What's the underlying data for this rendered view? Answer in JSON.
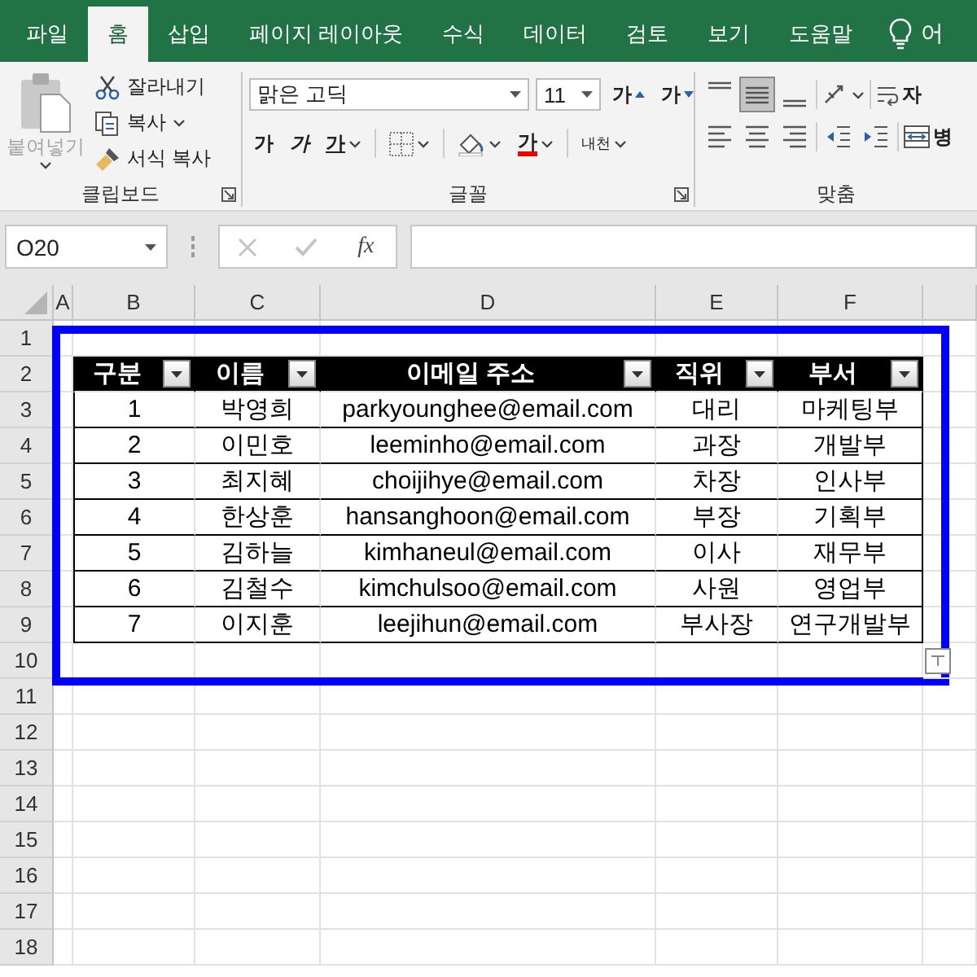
{
  "tabs": [
    {
      "label": "파일",
      "selected": false
    },
    {
      "label": "홈",
      "selected": true
    },
    {
      "label": "삽입",
      "selected": false
    },
    {
      "label": "페이지 레이아웃",
      "selected": false
    },
    {
      "label": "수식",
      "selected": false
    },
    {
      "label": "데이터",
      "selected": false
    },
    {
      "label": "검토",
      "selected": false
    },
    {
      "label": "보기",
      "selected": false
    },
    {
      "label": "도움말",
      "selected": false
    }
  ],
  "tell_me": {
    "text": "어"
  },
  "clipboard": {
    "label": "클립보드",
    "paste": {
      "label": "붙여넣기",
      "disabled": true
    },
    "cut": "잘라내기",
    "copy": "복사",
    "format_painter": "서식 복사"
  },
  "font": {
    "label": "글꼴",
    "font_name": "맑은 고딕",
    "font_size": "11",
    "grow": "가",
    "shrink": "가",
    "bold": "가",
    "italic": "가",
    "underline": "가",
    "font_color": "가",
    "phonetic": "내천"
  },
  "alignment": {
    "label": "맞춤",
    "vertical": [
      {
        "kind": "top",
        "selected": false
      },
      {
        "kind": "middle",
        "selected": true
      },
      {
        "kind": "bottom",
        "selected": false
      }
    ],
    "wrap_text": "자",
    "merge": "병"
  },
  "formula_bar": {
    "name_box": "O20",
    "function_label": "fx"
  },
  "sheet": {
    "columns": [
      "A",
      "B",
      "C",
      "D",
      "E",
      "F"
    ],
    "rows": [
      "1",
      "2",
      "3",
      "4",
      "5",
      "6",
      "7",
      "8",
      "9",
      "10",
      "11",
      "12",
      "13",
      "14",
      "15",
      "16",
      "17",
      "18"
    ],
    "table": {
      "headers": [
        "구분",
        "이름",
        "이메일 주소",
        "직위",
        "부서"
      ],
      "rows": [
        [
          "1",
          "박영희",
          "parkyounghee@email.com",
          "대리",
          "마케팅부"
        ],
        [
          "2",
          "이민호",
          "leeminho@email.com",
          "과장",
          "개발부"
        ],
        [
          "3",
          "최지혜",
          "choijihye@email.com",
          "차장",
          "인사부"
        ],
        [
          "4",
          "한상훈",
          "hansanghoon@email.com",
          "부장",
          "기획부"
        ],
        [
          "5",
          "김하늘",
          "kimhaneul@email.com",
          "이사",
          "재무부"
        ],
        [
          "6",
          "김철수",
          "kimchulsoo@email.com",
          "사원",
          "영업부"
        ],
        [
          "7",
          "이지훈",
          "leejihun@email.com",
          "부사장",
          "연구개발부"
        ]
      ]
    }
  }
}
